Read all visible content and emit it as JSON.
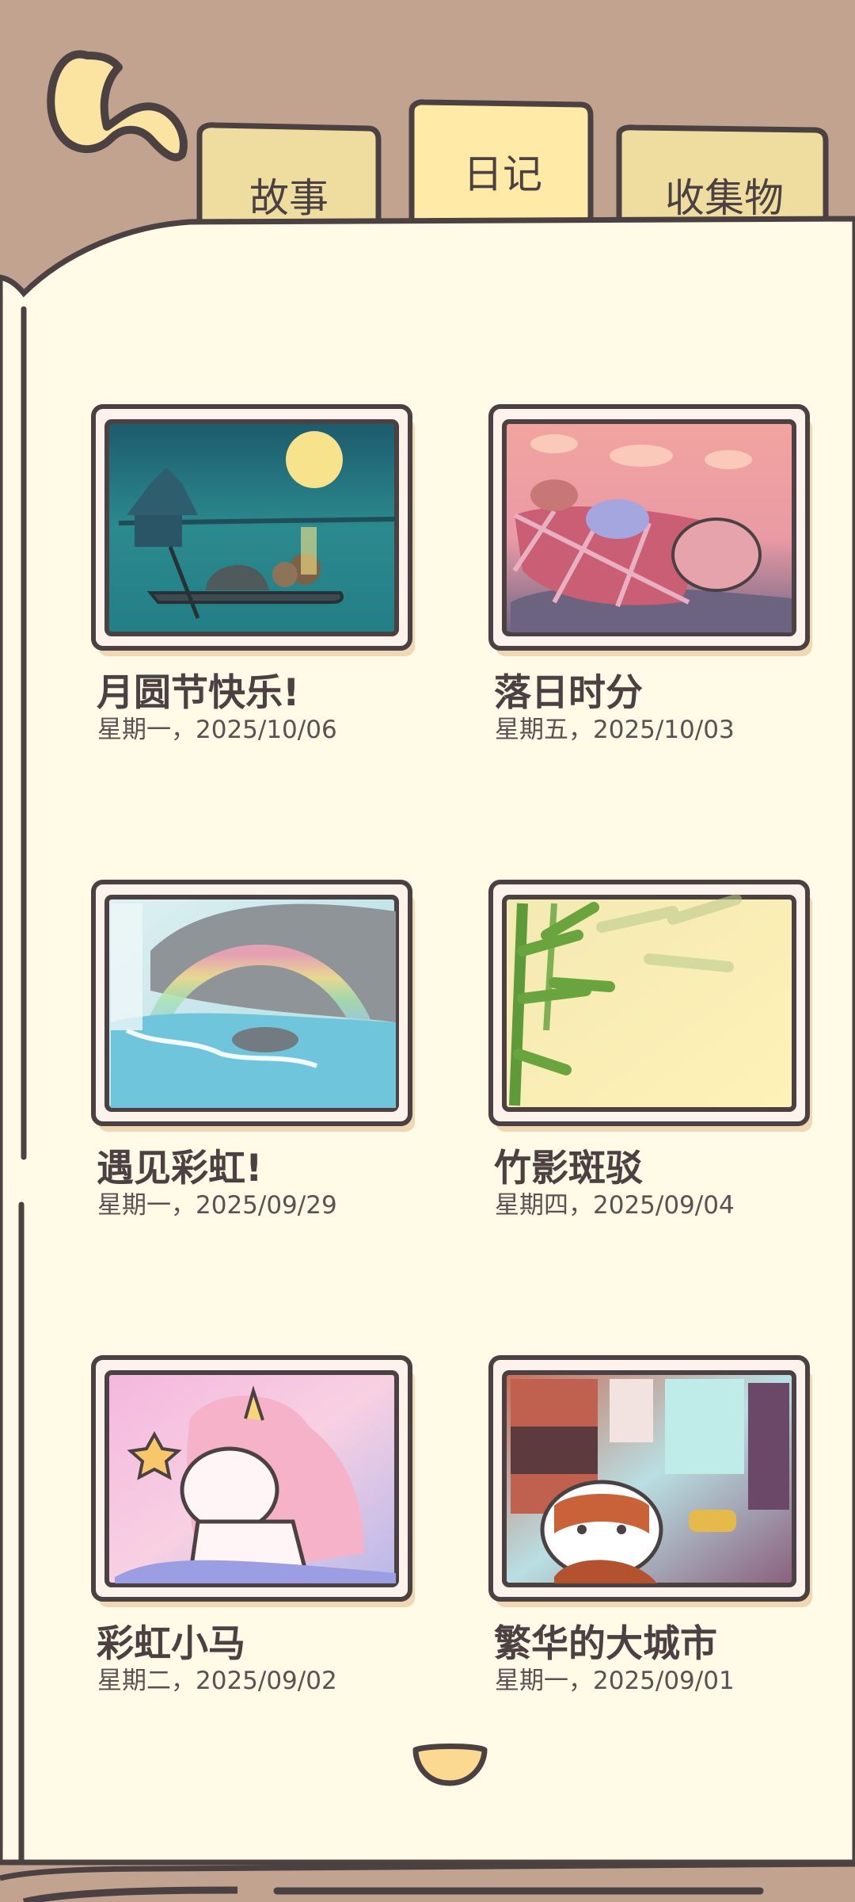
{
  "header": {
    "back_icon": "back-arrow-icon",
    "tabs": [
      {
        "label": "故事",
        "selected": false
      },
      {
        "label": "日记",
        "selected": true
      },
      {
        "label": "收集物",
        "selected": false
      }
    ]
  },
  "diary": {
    "entries": [
      {
        "title": "月圆节快乐!",
        "date": "星期一，2025/10/06",
        "image": "moon-festival-boat-illustration"
      },
      {
        "title": "落日时分",
        "date": "星期五，2025/10/03",
        "image": "sunset-picnic-illustration"
      },
      {
        "title": "遇见彩虹!",
        "date": "星期一，2025/09/29",
        "image": "rainbow-waterfall-illustration"
      },
      {
        "title": "竹影斑驳",
        "date": "星期四，2025/09/04",
        "image": "bamboo-shadow-illustration"
      },
      {
        "title": "彩虹小马",
        "date": "星期二，2025/09/02",
        "image": "rainbow-unicorn-illustration"
      },
      {
        "title": "繁华的大城市",
        "date": "星期一，2025/09/01",
        "image": "red-panda-city-illustration"
      }
    ],
    "next_page_icon": "next-page-tab-icon"
  },
  "colors": {
    "background": "#c2a38f",
    "page": "#fffbe6",
    "tab": "#efdda0",
    "tab_selected": "#ffeaa8",
    "outline": "#4c4142"
  }
}
